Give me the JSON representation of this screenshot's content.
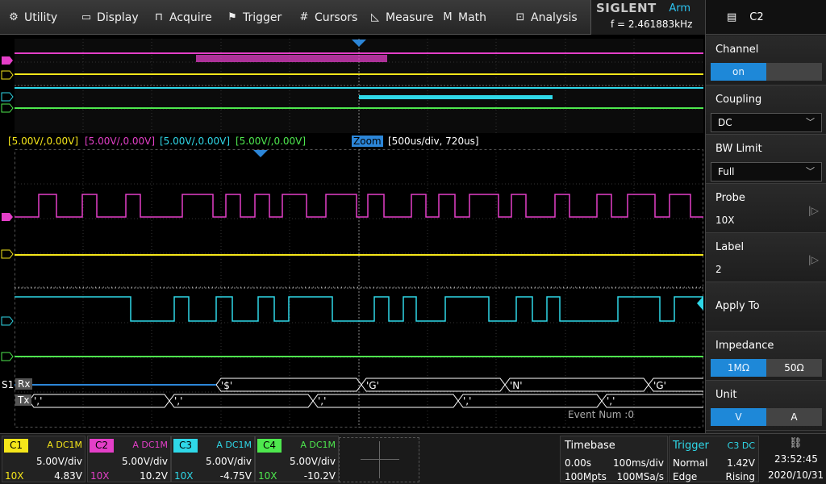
{
  "menu": {
    "utility": "Utility",
    "display": "Display",
    "acquire": "Acquire",
    "trigger": "Trigger",
    "cursors": "Cursors",
    "measure": "Measure",
    "math": "Math",
    "analysis": "Analysis"
  },
  "brand": {
    "logo": "SIGLENT",
    "state": "Arm",
    "frequency": "f = 2.461883kHz"
  },
  "panel": {
    "title": "C2",
    "channel": {
      "label": "Channel",
      "on": "on",
      "off": ""
    },
    "coupling": {
      "label": "Coupling",
      "value": "DC"
    },
    "bw_limit": {
      "label": "BW Limit",
      "value": "Full"
    },
    "probe": {
      "label": "Probe",
      "value": "10X"
    },
    "label": {
      "label": "Label",
      "value": "2"
    },
    "apply_to": {
      "label": "Apply To"
    },
    "impedance": {
      "label": "Impedance",
      "opt1": "1MΩ",
      "opt2": "50Ω"
    },
    "unit": {
      "label": "Unit",
      "opt1": "V",
      "opt2": "A"
    }
  },
  "scalebar": {
    "c1": "[5.00V/,0.00V]",
    "c2": "[5.00V/,0.00V]",
    "c3": "[5.00V/,0.00V]",
    "c4": "[5.00V/,0.00V]",
    "zoom": "Zoom",
    "zoom_info": "[500us/div, 720us]"
  },
  "decode": {
    "bus": "S1",
    "rx": "Rx",
    "tx": "Tx",
    "rx_frames": [
      "'$'",
      "'G'",
      "'N'",
      "'G'"
    ],
    "tx_frames": [
      "','",
      "','",
      "','",
      "','",
      "','"
    ],
    "event_num": "Event Num :0"
  },
  "channels": [
    {
      "name": "C1",
      "coupling": "A DC1M",
      "vdiv": "5.00V/div",
      "probe": "10X",
      "offset": "4.83V",
      "color": "#f5e61a"
    },
    {
      "name": "C2",
      "coupling": "A DC1M",
      "vdiv": "5.00V/div",
      "probe": "10X",
      "offset": "10.2V",
      "color": "#e43fc8"
    },
    {
      "name": "C3",
      "coupling": "A DC1M",
      "vdiv": "5.00V/div",
      "probe": "10X",
      "offset": "-4.75V",
      "color": "#2fd8e8"
    },
    {
      "name": "C4",
      "coupling": "A DC1M",
      "vdiv": "5.00V/div",
      "probe": "10X",
      "offset": "-10.2V",
      "color": "#4ee84e"
    }
  ],
  "timebase": {
    "label": "Timebase",
    "delay": "0.00s",
    "tdiv": "100ms/div",
    "points": "100Mpts",
    "srate": "100MSa/s"
  },
  "trigger": {
    "label": "Trigger",
    "source": "C3 DC",
    "mode": "Normal",
    "level": "1.42V",
    "type": "Edge",
    "slope": "Rising"
  },
  "clock": {
    "time": "23:52:45",
    "date": "2020/10/31"
  }
}
